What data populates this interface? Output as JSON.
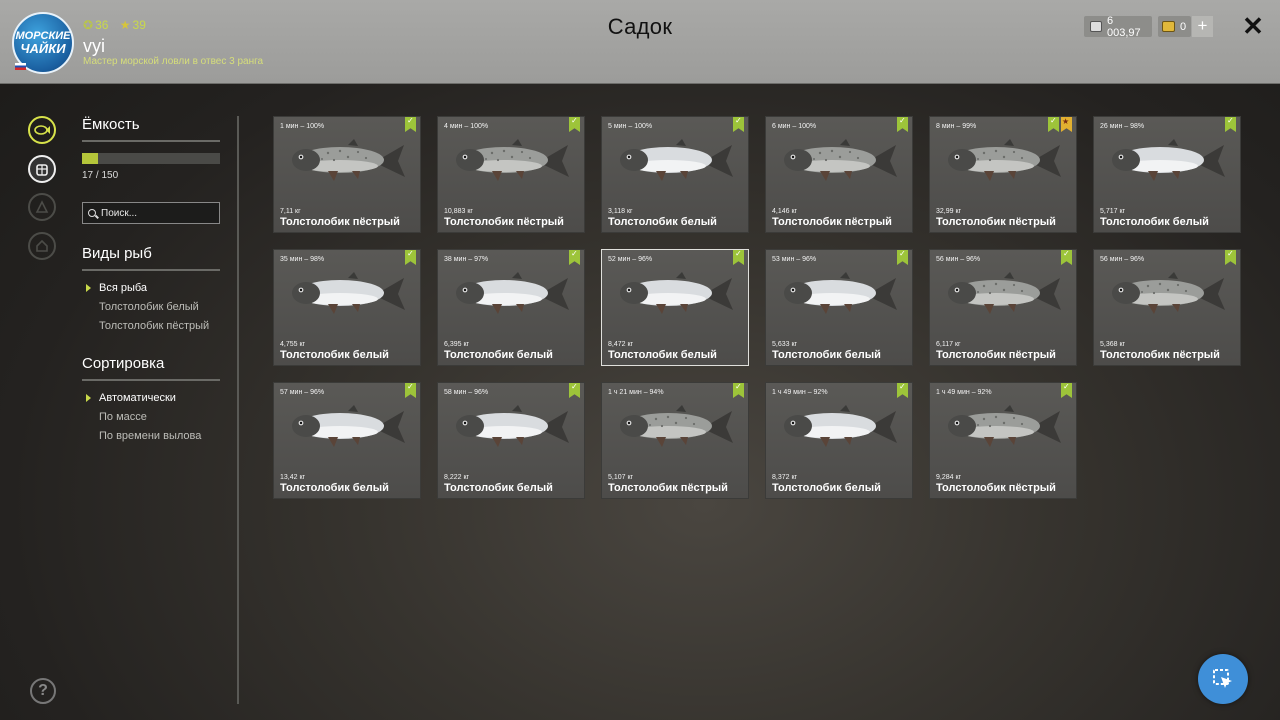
{
  "header": {
    "title": "Садок",
    "logo_text": [
      "МОРСКИЕ",
      "ЧАЙКИ"
    ],
    "coins": "36",
    "stars": "39",
    "username": "vyi",
    "rank": "Мастер морской ловли в отвес 3 ранга",
    "money": "6 003,97",
    "gold": "0"
  },
  "sidebar": {
    "capacity_title": "Ёмкость",
    "capacity_used": 17,
    "capacity_total": 150,
    "capacity_text": "17 / 150",
    "search_placeholder": "Поиск...",
    "species_title": "Виды рыб",
    "species": [
      "Вся рыба",
      "Толстолобик белый",
      "Толстолобик пёстрый"
    ],
    "species_selected": "Вся рыба",
    "sort_title": "Сортировка",
    "sort": [
      "Автоматически",
      "По массе",
      "По времени вылова"
    ],
    "sort_selected": "Автоматически"
  },
  "fish": [
    {
      "meta": "1 мин – 100%",
      "weight": "7,11 кг",
      "name": "Толстолобик пёстрый",
      "type": "spotted"
    },
    {
      "meta": "4 мин – 100%",
      "weight": "10,883 кг",
      "name": "Толстолобик пёстрый",
      "type": "spotted"
    },
    {
      "meta": "5 мин – 100%",
      "weight": "3,118 кг",
      "name": "Толстолобик белый",
      "type": "white"
    },
    {
      "meta": "6 мин – 100%",
      "weight": "4,146 кг",
      "name": "Толстолобик пёстрый",
      "type": "spotted"
    },
    {
      "meta": "8 мин – 99%",
      "weight": "32,99 кг",
      "name": "Толстолобик пёстрый",
      "type": "spotted",
      "trophy": true
    },
    {
      "meta": "26 мин – 98%",
      "weight": "5,717 кг",
      "name": "Толстолобик белый",
      "type": "white"
    },
    {
      "meta": "35 мин – 98%",
      "weight": "4,755 кг",
      "name": "Толстолобик белый",
      "type": "white"
    },
    {
      "meta": "38 мин – 97%",
      "weight": "6,395 кг",
      "name": "Толстолобик белый",
      "type": "white"
    },
    {
      "meta": "52 мин – 96%",
      "weight": "8,472 кг",
      "name": "Толстолобик белый",
      "type": "white",
      "selected": true
    },
    {
      "meta": "53 мин – 96%",
      "weight": "5,633 кг",
      "name": "Толстолобик белый",
      "type": "white"
    },
    {
      "meta": "56 мин – 96%",
      "weight": "6,117 кг",
      "name": "Толстолобик пёстрый",
      "type": "spotted"
    },
    {
      "meta": "56 мин – 96%",
      "weight": "5,368 кг",
      "name": "Толстолобик пёстрый",
      "type": "spotted"
    },
    {
      "meta": "57 мин – 96%",
      "weight": "13,42 кг",
      "name": "Толстолобик белый",
      "type": "white"
    },
    {
      "meta": "58 мин – 96%",
      "weight": "8,222 кг",
      "name": "Толстолобик белый",
      "type": "white"
    },
    {
      "meta": "1 ч 21 мин – 94%",
      "weight": "5,107 кг",
      "name": "Толстолобик пёстрый",
      "type": "spotted"
    },
    {
      "meta": "1 ч 49 мин – 92%",
      "weight": "8,372 кг",
      "name": "Толстолобик белый",
      "type": "white"
    },
    {
      "meta": "1 ч 49 мин – 92%",
      "weight": "9,284 кг",
      "name": "Толстолобик пёстрый",
      "type": "spotted"
    }
  ],
  "colors": {
    "accent": "#c9d94a",
    "check_badge": "#9dc43a",
    "trophy_badge": "#e2b030",
    "cursor_button": "#3f8fd8"
  },
  "icons": {
    "sidebar": [
      "fish-icon",
      "keepnet-icon",
      "lure-icon",
      "home-icon"
    ],
    "help": "help-icon",
    "close": "close-icon",
    "cursor_button": "cursor-icon"
  }
}
